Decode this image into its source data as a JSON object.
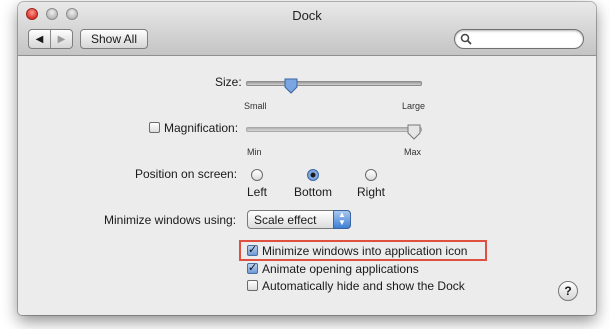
{
  "window": {
    "title": "Dock"
  },
  "toolbar": {
    "back_glyph": "◀",
    "forward_glyph": "▶",
    "show_all_label": "Show All",
    "search_placeholder": ""
  },
  "size": {
    "label": "Size:",
    "min_label": "Small",
    "max_label": "Large",
    "value": 0.23
  },
  "magnification": {
    "label": "Magnification:",
    "checked": false,
    "min_label": "Min",
    "max_label": "Max",
    "value": 1.0
  },
  "position": {
    "label": "Position on screen:",
    "options": [
      "Left",
      "Bottom",
      "Right"
    ],
    "selected": "Bottom"
  },
  "minimize": {
    "label": "Minimize windows using:",
    "value": "Scale effect"
  },
  "checkboxes": [
    {
      "label": "Minimize windows into application icon",
      "checked": true
    },
    {
      "label": "Animate opening applications",
      "checked": true
    },
    {
      "label": "Automatically hide and show the Dock",
      "checked": false
    }
  ],
  "help": {
    "glyph": "?"
  },
  "colors": {
    "highlight": "#e05040",
    "accent": "#5d8ed0"
  }
}
